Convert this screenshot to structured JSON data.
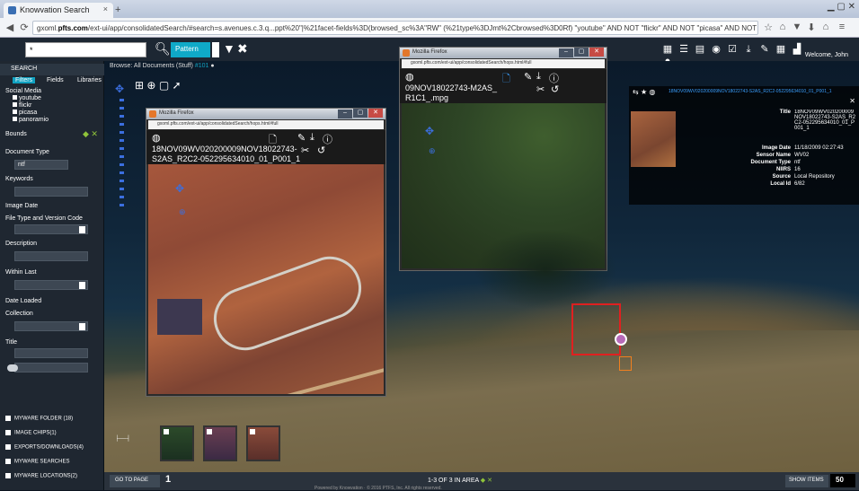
{
  "browser": {
    "tab_title": "Knowvation Search",
    "url_prefix": "gxoml.",
    "url_domain": "pfts.com",
    "url_rest": "/ext-ui/app/consolidatedSearch/#search=s.avenues.c.3.q...ppt%20\"|%21facet-fields%3D(browsed_sc%3A\"RW\" (%21type%3DJmt%2Cbrowsed%3D0Rf)  \"youtube\" AND NOT \"flickr\" AND NOT \"picasa\" AND NOT \"panoramio\"|%21fields%3D(_num%3D10,8023743%27)%21fields(_num%3A"
  },
  "app": {
    "search_value": "*",
    "pattern_label": "Pattern",
    "welcome": "Welcome, John",
    "breadcrumb": "Browse: All Documents (Stuff)",
    "breadcrumb_count": "#101"
  },
  "sidebar": {
    "header": "SEARCH",
    "tabs": [
      "Filters",
      "Fields",
      "Libraries"
    ],
    "social_media_label": "Social Media",
    "social_items": [
      "youtube",
      "flickr",
      "picasa",
      "panoramio"
    ],
    "bounds_label": "Bounds",
    "document_type_label": "Document Type",
    "document_type_value": "ntf",
    "keywords_label": "Keywords",
    "image_date_label": "Image Date",
    "file_type_label": "File Type and Version Code",
    "description_label": "Description",
    "within_last_label": "Within Last",
    "date_loaded_label": "Date Loaded",
    "collection_label": "Collection",
    "title_label": "Title",
    "bottom_items": [
      "MYWARE FOLDER (18)",
      "IMAGE CHIPS(1)",
      "EXPORTS/DOWNLOADS(4)",
      "MYWARE SEARCHES",
      "MYWARE LOCATIONS(2)"
    ]
  },
  "bottombar": {
    "goto_label": "GO TO PAGE",
    "page": "1",
    "page_info": "1-3 OF 3 IN AREA",
    "show_items_label": "SHOW ITEMS",
    "show_items_value": "50",
    "footer": "Powered by Knowvation · © 2016 PTFS, Inc. All rights reserved."
  },
  "popupA": {
    "window_title": "Mozilla Firefox",
    "url": "gxoml.pfts.com/ext-ui/app/consolidatedSearch/hops.html#full",
    "title": "18NOV09WV020200009NOV18022743-S2AS_R2C2-052295634010_01_P001_1"
  },
  "popupB": {
    "window_title": "Mozilla Firefox",
    "url": "gxoml.pfts.com/ext-ui/app/consolidatedSearch/hops.html#full",
    "title": "09NOV18022743-M2AS_R1C1_.mpg"
  },
  "detail": {
    "url_fragment": "18NOV09WV020200009NOV18022743-S2AS_R2C2-052295634010_01_P001_1",
    "fields": [
      {
        "key": "Title",
        "value": "18NOV09WV020200009NOV18022743-S2AS_R2C2-052295634010_01_P001_1"
      },
      {
        "key": "Image Date",
        "value": "11/18/2009 02:27:43"
      },
      {
        "key": "Sensor Name",
        "value": "WV02"
      },
      {
        "key": "Document Type",
        "value": "ntf"
      },
      {
        "key": "NIIRS",
        "value": "16"
      },
      {
        "key": "Source",
        "value": "Local Repository"
      },
      {
        "key": "Local Id",
        "value": "6/82"
      }
    ]
  },
  "colors": {
    "accent": "#10a1c1",
    "highlight_box": "#e02020",
    "secondary_box": "#f08020"
  }
}
